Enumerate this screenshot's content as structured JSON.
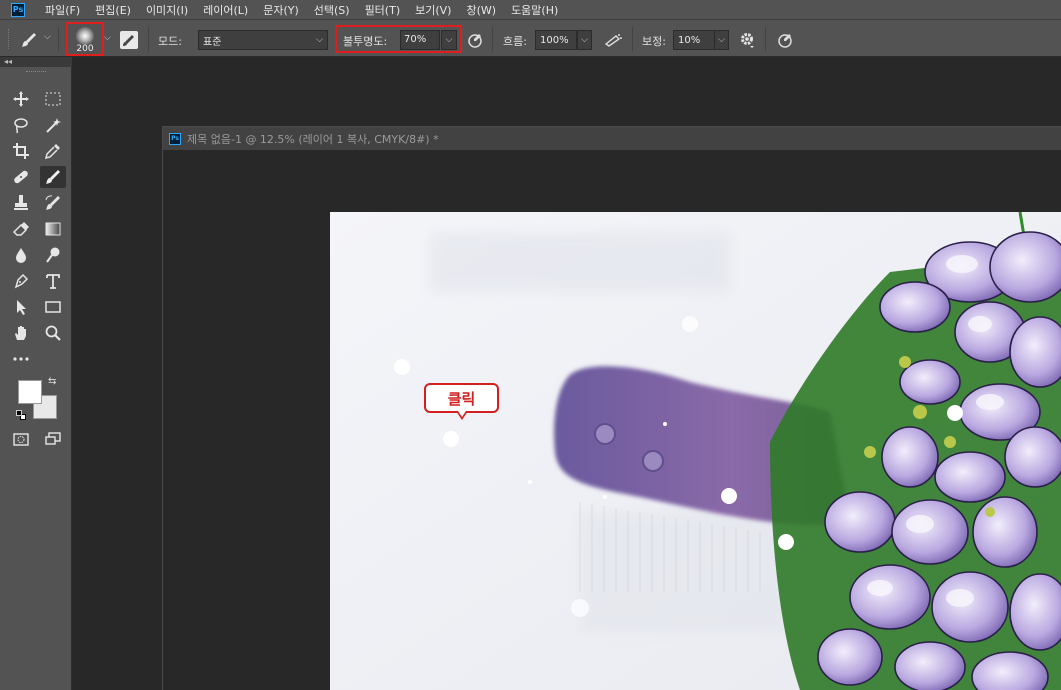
{
  "menu": [
    "파일(F)",
    "편집(E)",
    "이미지(I)",
    "레이어(L)",
    "문자(Y)",
    "선택(S)",
    "필터(T)",
    "보기(V)",
    "창(W)",
    "도움말(H)"
  ],
  "app_logo": "Ps",
  "options": {
    "brush_size": "200",
    "mode_label": "모드:",
    "mode_value": "표준",
    "opacity_label": "불투명도:",
    "opacity_value": "70%",
    "flow_label": "흐름:",
    "flow_value": "100%",
    "smoothing_label": "보정:",
    "smoothing_value": "10%"
  },
  "toolbar": {
    "collapse": "◂◂"
  },
  "document": {
    "title": "제목 없음-1 @ 12.5% (레이어 1 복사, CMYK/8#) *",
    "ps_logo": "Ps"
  },
  "callout": {
    "text": "클릭"
  },
  "colors": {
    "accent_red": "#e01e1e",
    "panel": "#535353",
    "workspace": "#282828",
    "petal": "#a48fd0",
    "leaf": "#3c8a2e"
  }
}
